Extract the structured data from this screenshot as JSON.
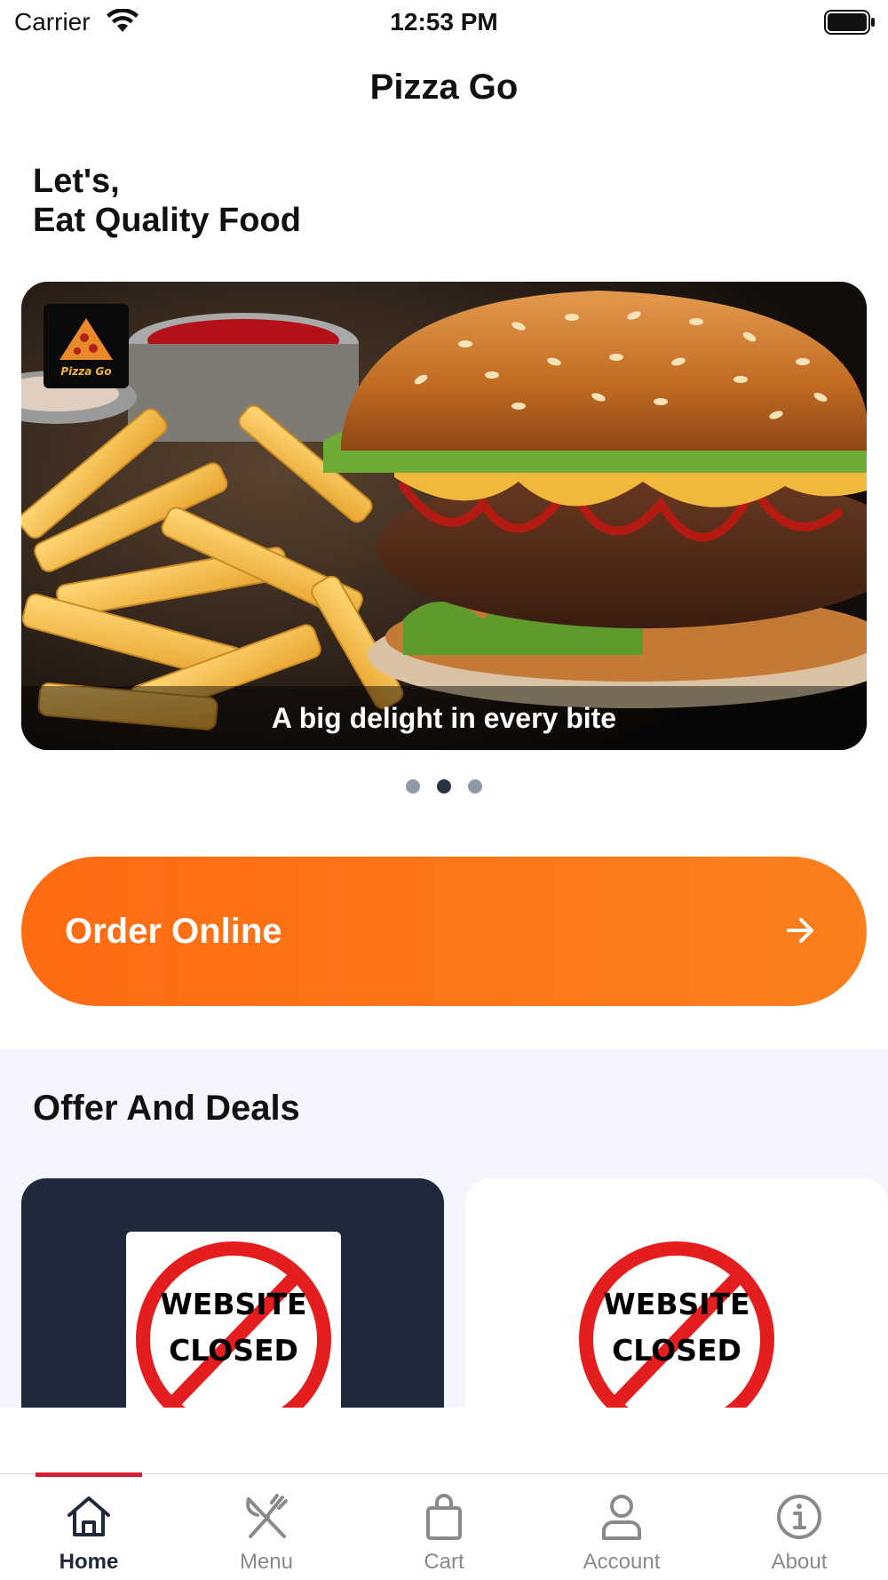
{
  "status_bar": {
    "carrier": "Carrier",
    "time": "12:53 PM",
    "icons": [
      "wifi-icon",
      "battery-icon"
    ]
  },
  "nav": {
    "title": "Pizza Go"
  },
  "greeting": {
    "line1": "Let's,",
    "line2": "Eat Quality Food"
  },
  "carousel": {
    "caption": "A big delight in every bite",
    "logo_text": "Pizza Go",
    "slide_count": 3,
    "active_index": 1
  },
  "order": {
    "label": "Order Online",
    "icon": "arrow-right-icon"
  },
  "offers": {
    "title": "Offer And Deals",
    "deals": [
      {
        "line1": "WEBSITE",
        "line2": "CLOSED"
      },
      {
        "line1": "WEBSITE",
        "line2": "CLOSED"
      }
    ]
  },
  "tabs": [
    {
      "label": "Home",
      "icon": "home-icon",
      "active": true
    },
    {
      "label": "Menu",
      "icon": "fork-knife-icon",
      "active": false
    },
    {
      "label": "Cart",
      "icon": "shopping-bag-icon",
      "active": false
    },
    {
      "label": "Account",
      "icon": "user-icon",
      "active": false
    },
    {
      "label": "About",
      "icon": "info-icon",
      "active": false
    }
  ],
  "colors": {
    "accent_orange": "#fe6b12",
    "tab_indicator": "#d22030",
    "dark_navy": "#1f293b",
    "offers_bg": "#f5f6fd"
  }
}
